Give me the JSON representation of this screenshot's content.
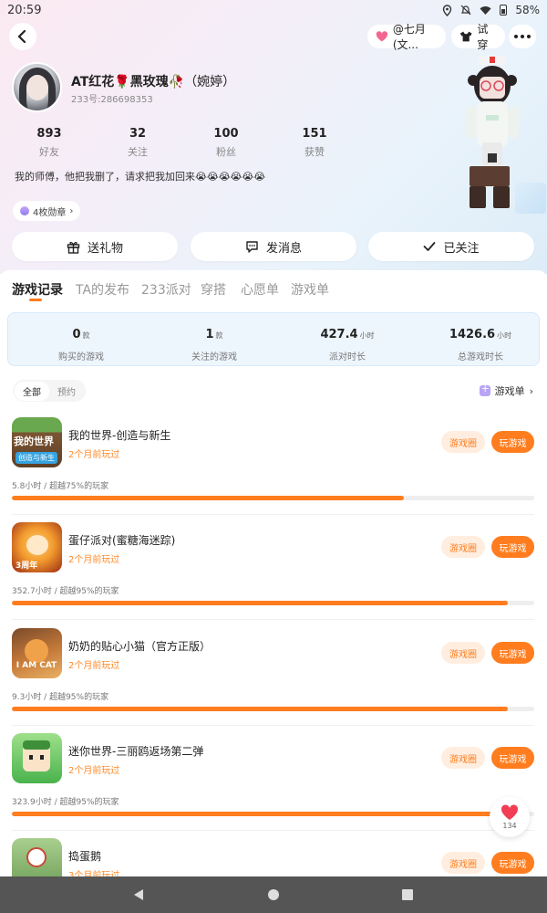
{
  "status_bar": {
    "time": "20:59",
    "battery": "58%"
  },
  "header": {
    "emotion_label": "@七月(文...",
    "tryon_label": "试穿"
  },
  "profile": {
    "nickname_main": "AT红花🌹黑玫瑰🥀",
    "nickname_extra": "（婉婷）",
    "uid": "233号:286698353",
    "stats": [
      {
        "value": "893",
        "label": "好友"
      },
      {
        "value": "32",
        "label": "关注"
      },
      {
        "value": "100",
        "label": "粉丝"
      },
      {
        "value": "151",
        "label": "获赞"
      }
    ],
    "bio": "我的师傅，他把我删了，请求把我加回来😭😭😭😭😭😭",
    "badge": "4枚勋章"
  },
  "actions": [
    {
      "label": "送礼物",
      "icon": "gift-icon"
    },
    {
      "label": "发消息",
      "icon": "message-icon"
    },
    {
      "label": "已关注",
      "icon": "check-icon"
    }
  ],
  "tabs": [
    "游戏记录",
    "TA的发布",
    "233派对",
    "穿搭",
    "心愿单",
    "游戏单"
  ],
  "summary": [
    {
      "value": "0",
      "unit": "款",
      "label": "购买的游戏"
    },
    {
      "value": "1",
      "unit": "款",
      "label": "关注的游戏"
    },
    {
      "value": "427.4",
      "unit": "小时",
      "label": "派对时长"
    },
    {
      "value": "1426.6",
      "unit": "小时",
      "label": "总游戏时长"
    }
  ],
  "filters": [
    "全部",
    "预约"
  ],
  "gamelist_link": "游戏单",
  "games": [
    {
      "title": "我的世界-创造与新生",
      "last_played": "2个月前玩过",
      "playtime": "5.8小时 / 超越75%的玩家",
      "progress": 0.75,
      "circle_label": "游戏圈",
      "play_label": "玩游戏",
      "icon_text": "我的世界",
      "icon_sub": "创造与新生"
    },
    {
      "title": "蛋仔派对(蜜糖海迷踪)",
      "last_played": "2个月前玩过",
      "playtime": "352.7小时 / 超越95%的玩家",
      "progress": 0.95,
      "circle_label": "游戏圈",
      "play_label": "玩游戏",
      "icon_text": "3周年"
    },
    {
      "title": "奶奶的贴心小猫（官方正版）",
      "last_played": "2个月前玩过",
      "playtime": "9.3小时 / 超越95%的玩家",
      "progress": 0.95,
      "circle_label": "游戏圈",
      "play_label": "玩游戏",
      "icon_text": "I AM CAT"
    },
    {
      "title": "迷你世界-三丽鸥返场第二弹",
      "last_played": "2个月前玩过",
      "playtime": "323.9小时 / 超越95%的玩家",
      "progress": 0.95,
      "circle_label": "游戏圈",
      "play_label": "玩游戏",
      "icon_text": ""
    },
    {
      "title": "捣蛋鹅",
      "last_played": "3个月前玩过",
      "playtime": "",
      "progress": 0,
      "circle_label": "游戏圈",
      "play_label": "玩游戏",
      "icon_text": ""
    }
  ],
  "like": {
    "count": "134"
  },
  "colors": {
    "accent": "#ff7d1e",
    "accent_soft": "#ffeee0",
    "card_bg": "#eef6fd"
  }
}
